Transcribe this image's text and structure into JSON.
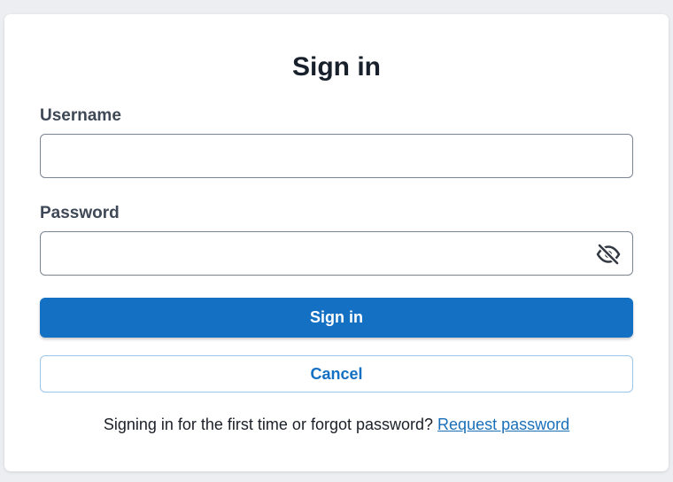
{
  "form": {
    "title": "Sign in",
    "username": {
      "label": "Username",
      "value": "",
      "placeholder": ""
    },
    "password": {
      "label": "Password",
      "value": "",
      "placeholder": "",
      "toggle_icon": "eye-slash-icon"
    },
    "submit_label": "Sign in",
    "cancel_label": "Cancel",
    "footer_text": "Signing in for the first time or forgot password?",
    "request_link_label": "Request password"
  },
  "colors": {
    "primary": "#1470c3",
    "background": "#eceef1",
    "card": "#ffffff",
    "text": "#17202b"
  }
}
